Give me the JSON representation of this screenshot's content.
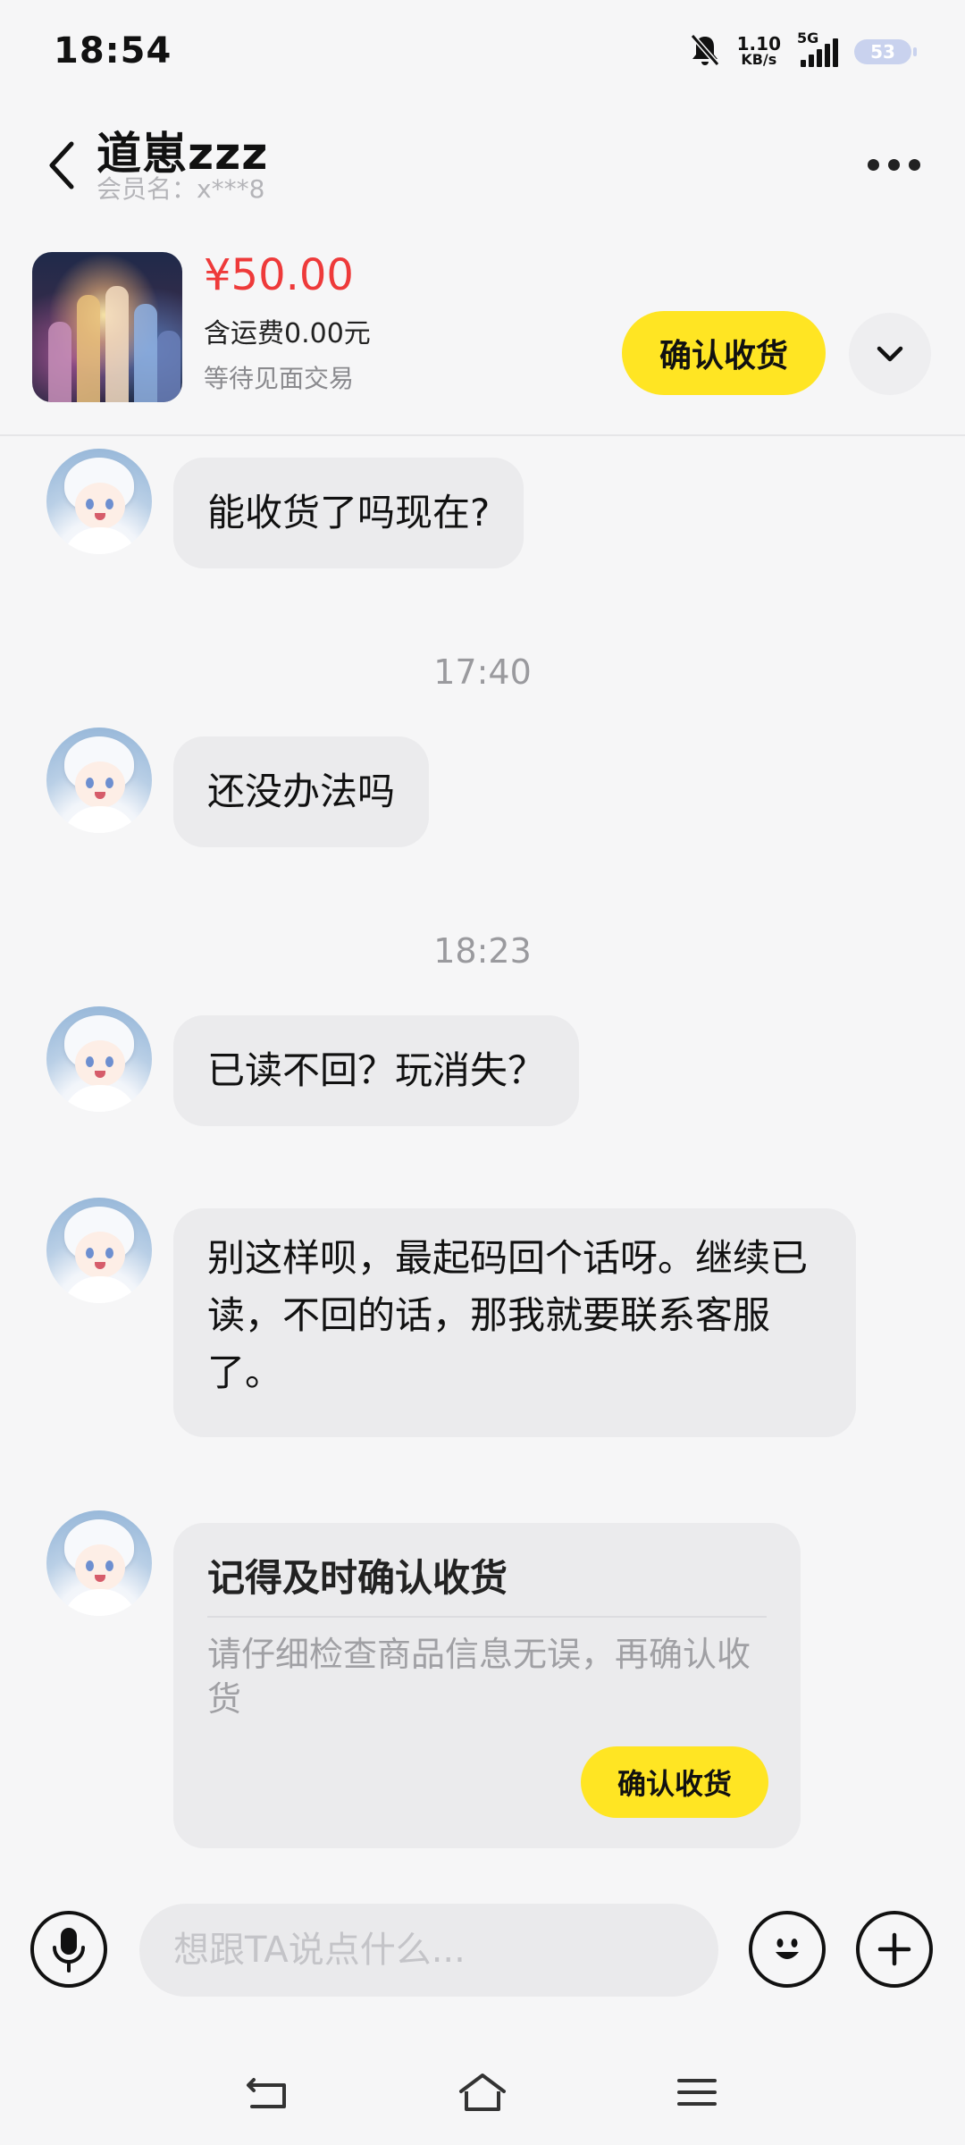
{
  "status_bar": {
    "time": "18:54",
    "net_speed_value": "1.10",
    "net_speed_unit": "KB/s",
    "network_type": "5G",
    "battery": "53",
    "icons": [
      "mute-bell-icon",
      "signal-bars-icon",
      "battery-icon"
    ]
  },
  "header": {
    "title": "道崽zzz",
    "member_label": "会员名：",
    "member_value": "x***8",
    "icons": [
      "back-chevron-icon",
      "more-dots-icon"
    ]
  },
  "product": {
    "price": "¥50.00",
    "shipping": "含运费0.00元",
    "status": "等待见面交易",
    "confirm_button": "确认收货",
    "icons": [
      "chevron-down-icon"
    ]
  },
  "messages": [
    {
      "type": "text",
      "text": "能收货了吗现在?"
    },
    {
      "type": "time",
      "text": "17:40"
    },
    {
      "type": "text",
      "text": "还没办法吗"
    },
    {
      "type": "time",
      "text": "18:23"
    },
    {
      "type": "text",
      "text": "已读不回？玩消失？"
    },
    {
      "type": "text",
      "text": "别这样呗，最起码回个话呀。继续已读，不回的话，那我就要联系客服了。"
    }
  ],
  "reminder_card": {
    "title": "记得及时确认收货",
    "body": "请仔细检查商品信息无误，再确认收货",
    "button": "确认收货"
  },
  "input_bar": {
    "placeholder": "想跟TA说点什么...",
    "value": "",
    "icons": [
      "microphone-icon",
      "emoji-icon",
      "plus-icon"
    ]
  },
  "nav_bar": {
    "icons": [
      "nav-back-icon",
      "nav-home-icon",
      "nav-menu-icon"
    ]
  },
  "colors": {
    "accent_yellow": "#ffe523",
    "price_red": "#ee3a3a",
    "bubble_gray": "#ebebed",
    "background": "#f6f6f7"
  }
}
